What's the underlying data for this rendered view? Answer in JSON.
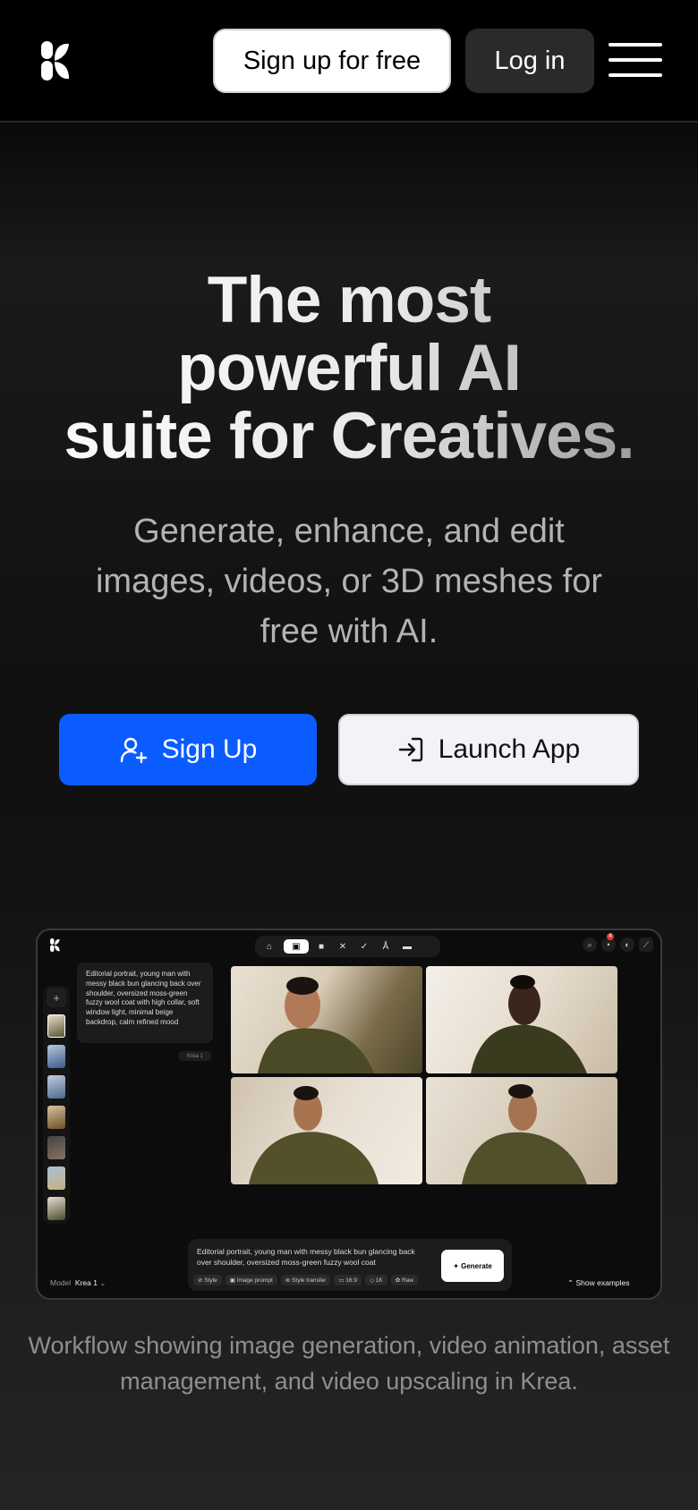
{
  "header": {
    "logo_icon": "krea-logo-icon",
    "signup_free_label": "Sign up for free",
    "login_label": "Log in",
    "menu_icon": "hamburger-menu-icon"
  },
  "hero": {
    "title_line1": "The most",
    "title_line2": "powerful AI",
    "title_line3": "suite for Creatives.",
    "subtitle": "Generate, enhance, and edit images, videos, or 3D meshes for free with AI.",
    "cta_signup": {
      "label": "Sign Up",
      "icon": "user-plus-icon",
      "color": "#0a5cff"
    },
    "cta_launch": {
      "label": "Launch App",
      "icon": "sign-in-icon"
    }
  },
  "app_preview": {
    "toolbar_icons": [
      "home-icon",
      "image-icon",
      "video-icon",
      "enhance-icon",
      "edit-icon",
      "realtime-icon",
      "folder-icon"
    ],
    "active_tool": "image-icon",
    "notification_count": "4",
    "prompt_card_text": "Editorial portrait, young man with messy black bun glancing back over shoulder, oversized moss-green fuzzy wool coat with high collar, soft window light, minimal beige backdrop, calm refined mood",
    "prompt_model_tag": "Krea 1",
    "prompt_input_text": "Editorial portrait, young man with messy black bun glancing back over shoulder, oversized moss-green fuzzy wool coat",
    "chips": [
      "Style",
      "Image prompt",
      "Style transfer",
      "16:9",
      "1K",
      "Raw"
    ],
    "generate_label": "Generate",
    "model_label": "Model",
    "model_value": "Krea 1",
    "show_examples_label": "Show examples"
  },
  "caption": "Workflow showing image generation, video animation, asset management, and video upscaling in Krea."
}
